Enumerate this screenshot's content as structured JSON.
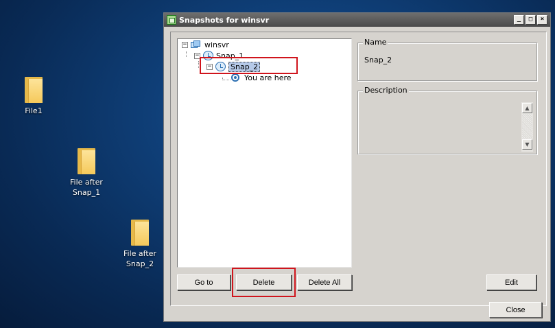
{
  "desktop": {
    "icons": [
      {
        "label_line1": "File1",
        "label_line2": ""
      },
      {
        "label_line1": "File after",
        "label_line2": "Snap_1"
      },
      {
        "label_line1": "File after",
        "label_line2": "Snap_2"
      }
    ]
  },
  "window": {
    "title": "Snapshots for winsvr",
    "controls": {
      "minimize": "_",
      "maximize": "□",
      "close": "×"
    }
  },
  "tree": {
    "root": "winsvr",
    "snap1": "Snap_1",
    "snap2": "Snap_2",
    "current": "You are here",
    "expand_glyph": "−"
  },
  "details": {
    "name_label": "Name",
    "name_value": "Snap_2",
    "description_label": "Description",
    "description_value": ""
  },
  "buttons": {
    "goto": "Go to",
    "delete": "Delete",
    "delete_all": "Delete All",
    "edit": "Edit",
    "close": "Close"
  },
  "scroll": {
    "up": "▲",
    "down": "▼"
  },
  "colors": {
    "highlight_box": "#d0141c",
    "selection": "#b5c9e8",
    "window_face": "#d6d3ce"
  }
}
